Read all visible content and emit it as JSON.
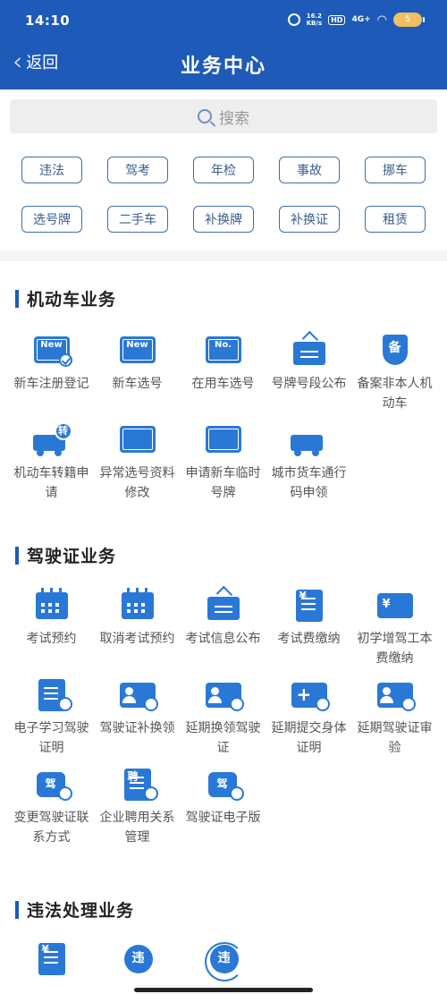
{
  "status": {
    "time": "14:10",
    "net_speed_value": "16.2",
    "net_speed_unit": "KB/s",
    "hd": "HD",
    "signal": "4G+",
    "battery": "5"
  },
  "nav": {
    "back_label": "返回",
    "title": "业务中心"
  },
  "search": {
    "placeholder": "搜索"
  },
  "chips": [
    "违法",
    "驾考",
    "年检",
    "事故",
    "挪车",
    "选号牌",
    "二手车",
    "补换牌",
    "补换证",
    "租赁"
  ],
  "sections": {
    "vehicle": {
      "title": "机动车业务",
      "items": [
        {
          "label": "新车注册登记",
          "icon": "new-plate-check-icon",
          "mark": "New"
        },
        {
          "label": "新车选号",
          "icon": "new-plate-icon",
          "mark": "New"
        },
        {
          "label": "在用车选号",
          "icon": "plate-number-icon",
          "mark": "No."
        },
        {
          "label": "号牌号段公布",
          "icon": "hanging-sign-icon",
          "mark": ""
        },
        {
          "label": "备案非本人机动车",
          "icon": "shield-icon",
          "mark": "备"
        },
        {
          "label": "机动车转籍申请",
          "icon": "truck-transfer-icon",
          "mark": "转"
        },
        {
          "label": "异常选号资料修改",
          "icon": "plate-edit-icon",
          "mark": ""
        },
        {
          "label": "申请新车临时号牌",
          "icon": "temporary-plate-icon",
          "mark": ""
        },
        {
          "label": "城市货车通行码申领",
          "icon": "cargo-truck-icon",
          "mark": ""
        }
      ]
    },
    "license": {
      "title": "驾驶证业务",
      "items": [
        {
          "label": "考试预约",
          "icon": "calendar-icon",
          "mark": ""
        },
        {
          "label": "取消考试预约",
          "icon": "calendar-cancel-icon",
          "mark": ""
        },
        {
          "label": "考试信息公布",
          "icon": "sign-check-icon",
          "mark": ""
        },
        {
          "label": "考试费缴纳",
          "icon": "fee-receipt-icon",
          "mark": "¥"
        },
        {
          "label": "初学增驾工本费缴纳",
          "icon": "fee-card-icon",
          "mark": "¥"
        },
        {
          "label": "电子学习驾驶证明",
          "icon": "document-user-icon",
          "mark": ""
        },
        {
          "label": "驾驶证补换领",
          "icon": "id-card-refresh-icon",
          "mark": ""
        },
        {
          "label": "延期换领驾驶证",
          "icon": "id-card-clock-icon",
          "mark": ""
        },
        {
          "label": "延期提交身体证明",
          "icon": "medical-clock-icon",
          "mark": "+"
        },
        {
          "label": "延期驾驶证审验",
          "icon": "id-card-check-icon",
          "mark": ""
        },
        {
          "label": "变更驾驶证联系方式",
          "icon": "license-phone-icon",
          "mark": "驾"
        },
        {
          "label": "企业聘用关系管理",
          "icon": "hire-document-icon",
          "mark": "聘"
        },
        {
          "label": "驾驶证电子版",
          "icon": "license-electronic-icon",
          "mark": "驾"
        }
      ]
    },
    "violation": {
      "title": "违法处理业务",
      "items": [
        {
          "label": "",
          "icon": "fine-receipt-icon",
          "mark": "¥"
        },
        {
          "label": "",
          "icon": "violation-hand-icon",
          "mark": "违"
        },
        {
          "label": "",
          "icon": "violation-search-icon",
          "mark": "违"
        }
      ]
    }
  }
}
